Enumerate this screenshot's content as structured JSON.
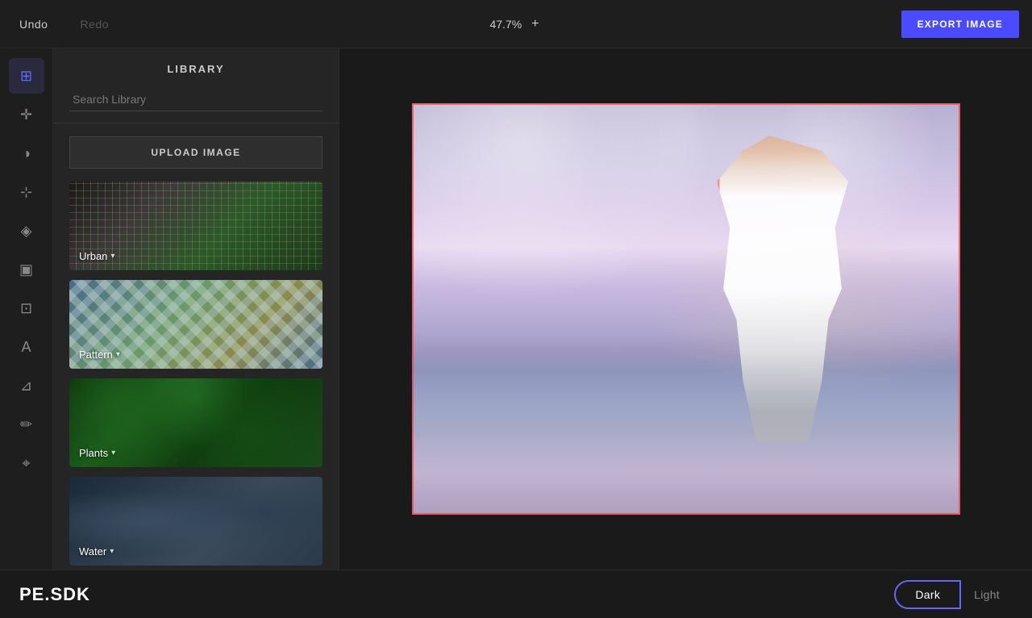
{
  "toolbar": {
    "undo_label": "Undo",
    "redo_label": "Redo",
    "zoom_value": "47.7%",
    "zoom_plus": "+",
    "export_label": "EXPORT IMAGE"
  },
  "sidebar": {
    "icons": [
      {
        "name": "layers-icon",
        "symbol": "⊞",
        "active": true
      },
      {
        "name": "add-icon",
        "symbol": "✛",
        "active": false
      },
      {
        "name": "paint-icon",
        "symbol": "◑",
        "active": false
      },
      {
        "name": "nodes-icon",
        "symbol": "⊹",
        "active": false
      },
      {
        "name": "drop-icon",
        "symbol": "◈",
        "active": false
      },
      {
        "name": "frame-icon",
        "symbol": "▣",
        "active": false
      },
      {
        "name": "crop-icon",
        "symbol": "⊡",
        "active": false
      },
      {
        "name": "text-icon",
        "symbol": "A",
        "active": false
      },
      {
        "name": "bookmark-icon",
        "symbol": "⊿",
        "active": false
      },
      {
        "name": "brush-icon",
        "symbol": "✏",
        "active": false
      },
      {
        "name": "lasso-icon",
        "symbol": "⌖",
        "active": false
      }
    ]
  },
  "library": {
    "title": "LIBRARY",
    "search_placeholder": "Search Library",
    "upload_label": "UPLOAD IMAGE",
    "items": [
      {
        "id": "urban",
        "label": "Urban",
        "style_class": "urban-bg"
      },
      {
        "id": "pattern",
        "label": "Pattern",
        "style_class": "pattern-bg"
      },
      {
        "id": "plants",
        "label": "Plants",
        "style_class": "plants-bg"
      },
      {
        "id": "water",
        "label": "Water",
        "style_class": "water-bg"
      }
    ]
  },
  "canvas": {
    "alt": "Woman at beach with arms raised"
  },
  "bottom": {
    "logo": "PE.SDK",
    "theme_dark": "Dark",
    "theme_light": "Light"
  }
}
